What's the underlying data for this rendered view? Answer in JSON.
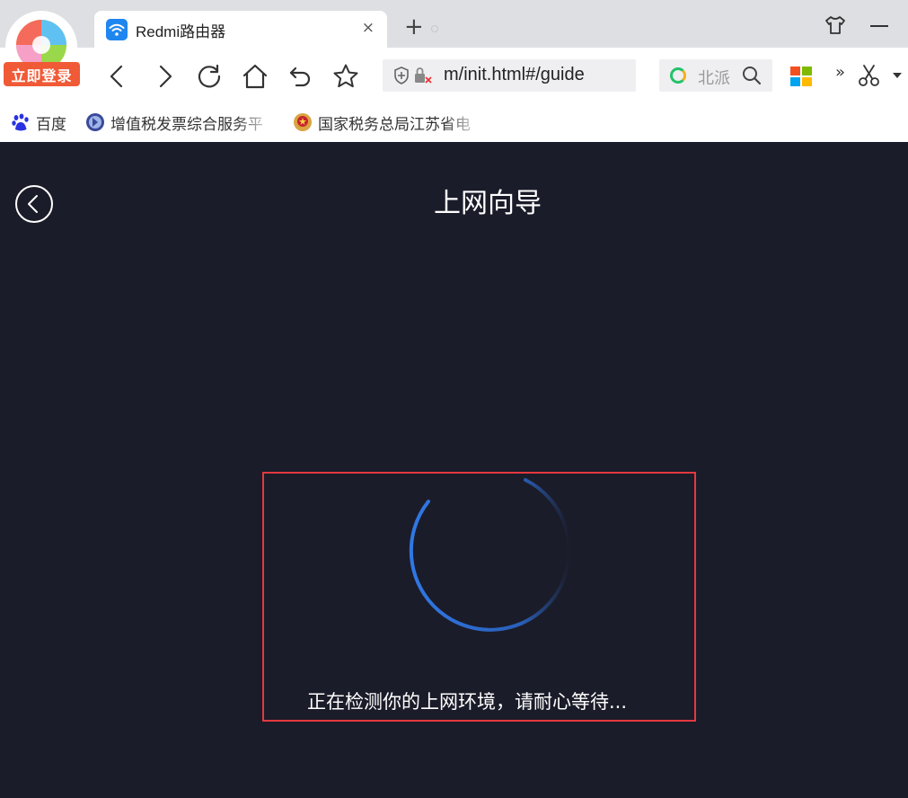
{
  "browser": {
    "login_badge": "立即登录",
    "tab": {
      "title": "Redmi路由器",
      "close": "×"
    },
    "new_tab": "+",
    "address": {
      "url": "m/init.html#/guide"
    },
    "search": {
      "placeholder": "北派"
    },
    "more": "»",
    "bookmarks": [
      {
        "label": "百度",
        "icon": "baidu-paw-icon"
      },
      {
        "label": "增值税发票综合服务平",
        "icon": "tax-service-icon"
      },
      {
        "label": "国家税务总局江苏省电",
        "icon": "national-emblem-icon"
      }
    ]
  },
  "page": {
    "title": "上网向导",
    "status_text": "正在检测你的上网环境，请耐心等待..."
  },
  "colors": {
    "page_bg": "#1b1c29",
    "highlight_border": "#e4383f",
    "spinner": "#2f6fd8",
    "login_badge": "#f05a36",
    "tab_favicon": "#1f86f0"
  }
}
